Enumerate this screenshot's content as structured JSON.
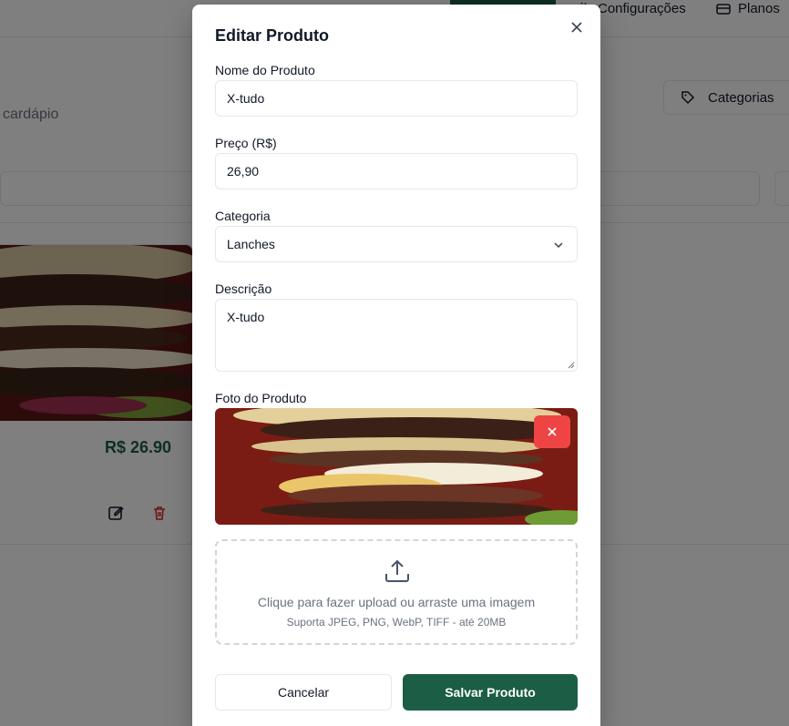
{
  "background": {
    "nav": {
      "settings_label": "Configurações",
      "plans_label": "Planos"
    },
    "subtitle": "cardápio",
    "categories_button": "Categorias",
    "product_card": {
      "price": "R$ 26.90"
    }
  },
  "modal": {
    "title": "Editar Produto",
    "name": {
      "label": "Nome do Produto",
      "value": "X-tudo"
    },
    "price": {
      "label": "Preço (R$)",
      "value": "26,90"
    },
    "category": {
      "label": "Categoria",
      "value": "Lanches"
    },
    "description": {
      "label": "Descrição",
      "value": "X-tudo"
    },
    "photo": {
      "label": "Foto do Produto"
    },
    "upload": {
      "main_text": "Clique para fazer upload ou arraste uma imagem",
      "sub_text": "Suporta JPEG, PNG, WebP, TIFF - até 20MB"
    },
    "cancel_label": "Cancelar",
    "save_label": "Salvar Produto"
  },
  "colors": {
    "primary": "#1b5e45",
    "danger": "#ef4444",
    "overlay": "rgba(0,0,0,0.5)"
  }
}
